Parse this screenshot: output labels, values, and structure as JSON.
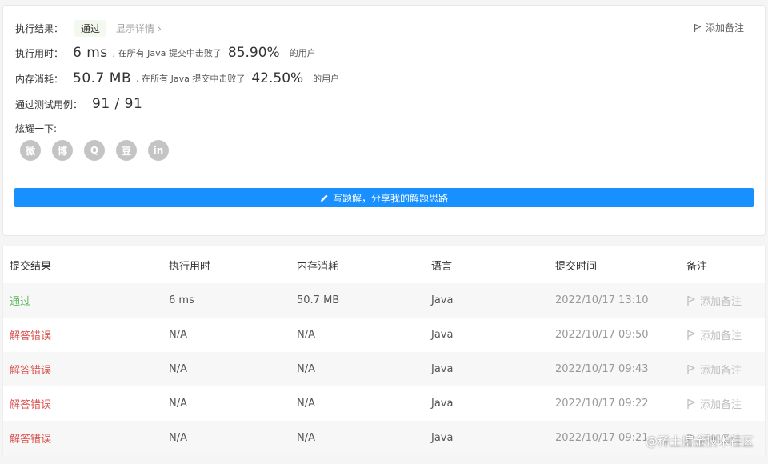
{
  "result": {
    "status_label": "执行结果：",
    "status_value": "通过",
    "details_link": "显示详情",
    "add_note": "添加备注",
    "runtime": {
      "label": "执行用时：",
      "value": "6 ms",
      "mid_text": ", 在所有 Java 提交中击败了",
      "percent": "85.90%",
      "suffix": "的用户"
    },
    "memory": {
      "label": "内存消耗：",
      "value": "50.7 MB",
      "mid_text": ", 在所有 Java 提交中击败了",
      "percent": "42.50%",
      "suffix": "的用户"
    },
    "testcases": {
      "label": "通过测试用例：",
      "value": "91 / 91"
    },
    "share_label": "炫耀一下:",
    "share_icons": [
      "wechat-icon",
      "weibo-icon",
      "qq-icon",
      "douban-icon",
      "linkedin-icon"
    ],
    "share_glyphs": [
      "微",
      "博",
      "Q",
      "豆",
      "in"
    ],
    "write_button": "写题解，分享我的解题思路"
  },
  "table": {
    "headers": [
      "提交结果",
      "执行用时",
      "内存消耗",
      "语言",
      "提交时间",
      "备注"
    ],
    "rows": [
      {
        "status": "通过",
        "runtime": "6 ms",
        "memory": "50.7 MB",
        "language": "Java",
        "time": "2022/10/17 13:10",
        "note": "添加备注"
      },
      {
        "status": "解答错误",
        "runtime": "N/A",
        "memory": "N/A",
        "language": "Java",
        "time": "2022/10/17 09:50",
        "note": "添加备注"
      },
      {
        "status": "解答错误",
        "runtime": "N/A",
        "memory": "N/A",
        "language": "Java",
        "time": "2022/10/17 09:43",
        "note": "添加备注"
      },
      {
        "status": "解答错误",
        "runtime": "N/A",
        "memory": "N/A",
        "language": "Java",
        "time": "2022/10/17 09:22",
        "note": "添加备注"
      },
      {
        "status": "解答错误",
        "runtime": "N/A",
        "memory": "N/A",
        "language": "Java",
        "time": "2022/10/17 09:21",
        "note": "添加备注"
      }
    ]
  },
  "watermark": "@稀土掘金技术社区",
  "colors": {
    "accent": "#1890ff",
    "success": "#5cb85c",
    "error": "#d9534f"
  }
}
